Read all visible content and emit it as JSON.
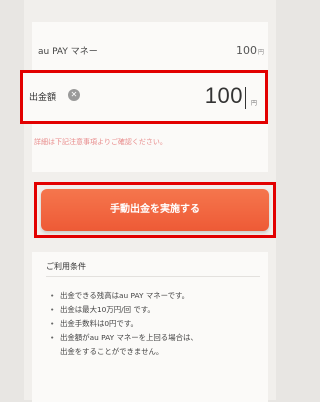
{
  "balance": {
    "label": "au PAY マネー",
    "amount": "100",
    "unit": "円"
  },
  "withdraw": {
    "label": "出金額",
    "value": "100",
    "unit": "円",
    "clear_icon": "clear-icon"
  },
  "note": "詳細は下記注意事項よりご確認ください。",
  "submit_label": "手動出金を実施する",
  "terms": {
    "title": "ご利用条件",
    "items": [
      "出金できる残高はau PAY マネーです。",
      "出金は最大10万円/回 です。",
      "出金手数料は0円です。",
      "出金額がau PAY マネーを上回る場合は、\n出金をすることができません。"
    ]
  },
  "colors": {
    "accent": "#ee5a36",
    "highlight_border": "#e20000",
    "note_text": "#e88a8a"
  }
}
